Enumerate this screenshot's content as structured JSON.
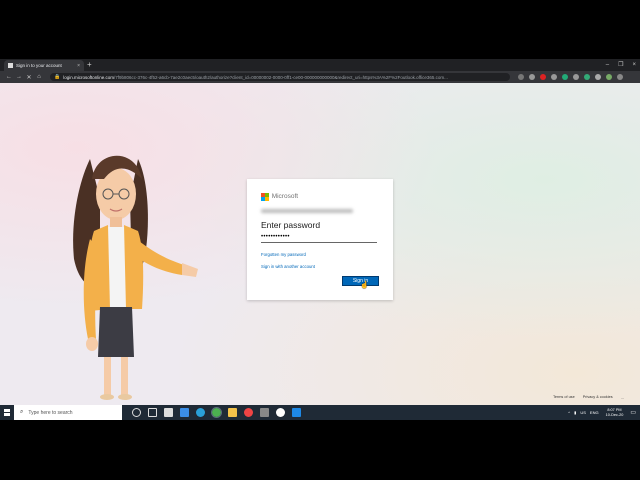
{
  "browser": {
    "tab_title": "Sign in to your account",
    "tab_close": "×",
    "new_tab": "+",
    "window_controls": [
      "–",
      "❐",
      "×"
    ],
    "nav": [
      "←",
      "→",
      "✕",
      "⌂"
    ],
    "url_host": "login.microsoftonline.com",
    "url_rest": "/7f9b806cc-376c-4f52-a6cb-7ae2c0aec5/oauth2/authorize?client_id=00000002-0000-0ff1-ce00-000000000000&redirect_uri=https%3A%2F%2Foutlook.office365.com..."
  },
  "signin": {
    "brand": "Microsoft",
    "title": "Enter password",
    "password_value": "••••••••••••",
    "forgot_link": "Forgotten my password",
    "other_account_link": "Sign in with another account",
    "signin_button": "Sign in",
    "brand_colors": [
      "#f25022",
      "#7fba00",
      "#00a4ef",
      "#ffb900"
    ]
  },
  "footer": {
    "terms": "Terms of use",
    "privacy": "Privacy & cookies",
    "more": "..."
  },
  "taskbar": {
    "search_placeholder": "Type here to search",
    "language": "ENG",
    "region": "US",
    "time": "8:07 PM",
    "date": "10-Dec-20"
  }
}
